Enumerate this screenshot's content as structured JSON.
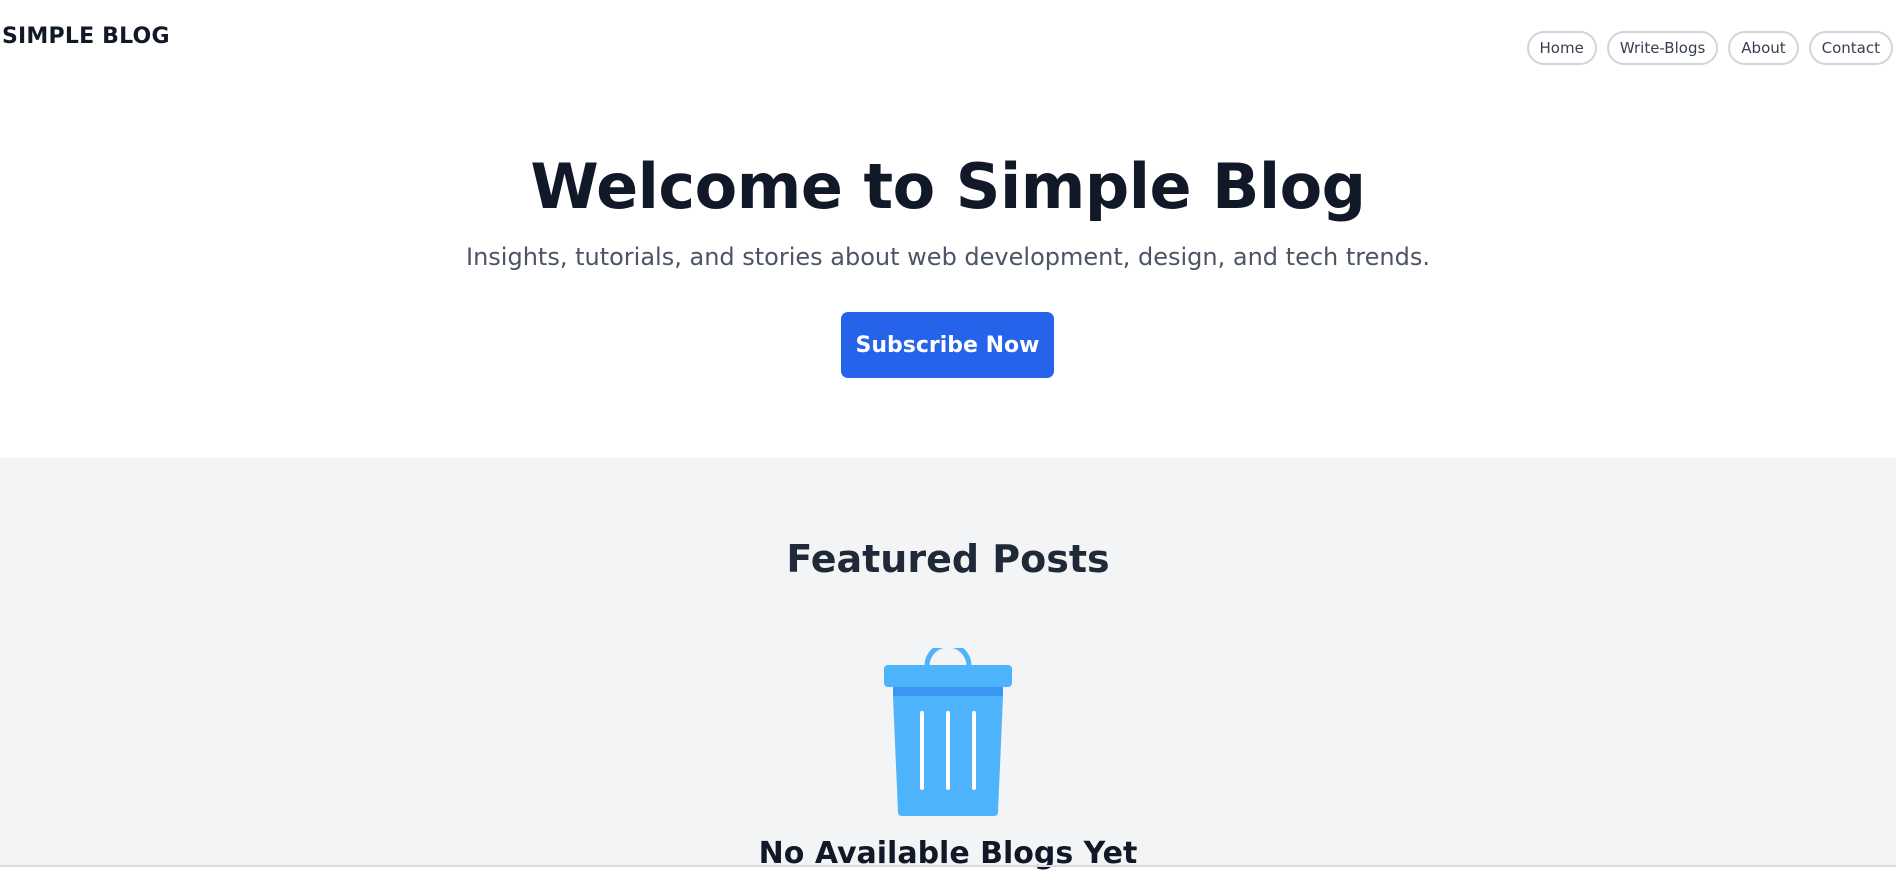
{
  "header": {
    "brand": "SIMPLE BLOG",
    "nav": {
      "home": "Home",
      "write_blogs": "Write-Blogs",
      "about": "About",
      "contact": "Contact"
    }
  },
  "hero": {
    "title": "Welcome to Simple Blog",
    "subtitle": "Insights, tutorials, and stories about web development, design, and tech trends.",
    "cta_label": "Subscribe Now"
  },
  "featured": {
    "title": "Featured Posts",
    "empty_icon": "trash-icon",
    "empty_message": "No Available Blogs Yet"
  },
  "colors": {
    "accent": "#2563eb",
    "section_bg": "#f3f4f6",
    "trash_icon": "#4db3fb"
  }
}
